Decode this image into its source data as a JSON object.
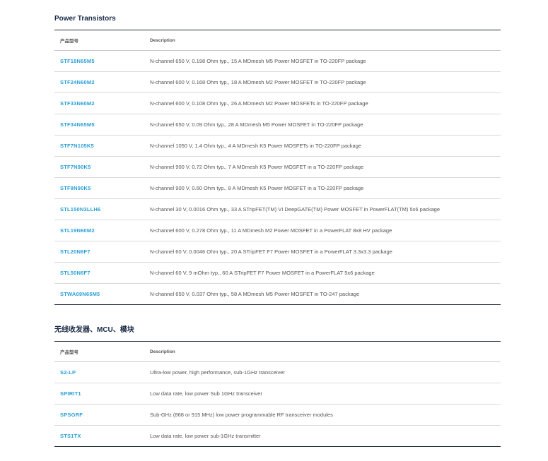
{
  "sections": [
    {
      "title": "Power Transistors",
      "header": {
        "part": "产品型号",
        "description": "Description"
      },
      "rows": [
        {
          "part": "STF18N65M5",
          "description": "N-channel 650 V, 0.198 Ohm typ., 15 A MDmesh M5 Power MOSFET in TO-220FP package"
        },
        {
          "part": "STF24N60M2",
          "description": "N-channel 600 V, 0.168 Ohm typ., 18 A MDmesh M2 Power MOSFET in TO-220FP package"
        },
        {
          "part": "STF33N60M2",
          "description": "N-channel 600 V, 0.108 Ohm typ., 26 A MDmesh M2 Power MOSFETs in TO-220FP package"
        },
        {
          "part": "STF34N65M5",
          "description": "N-channel 650 V, 0.09 Ohm typ., 28 A MDmesh M5 Power MOSFET in TO-220FP package"
        },
        {
          "part": "STF7N105K5",
          "description": "N-channel 1050 V, 1.4 Ohm typ., 4 A MDmesh K5 Power MOSFETs in TO-220FP package"
        },
        {
          "part": "STF7N90K5",
          "description": "N-channel 900 V, 0.72 Ohm typ., 7 A MDmesh K5 Power MOSFET in a TO-220FP package"
        },
        {
          "part": "STF8N90K5",
          "description": "N-channel 900 V, 0.60 Ohm typ., 8 A MDmesh K5 Power MOSFET in a TO-220FP package"
        },
        {
          "part": "STL150N3LLH6",
          "description": "N-channel 30 V, 0.0016 Ohm typ., 33 A STripFET(TM) VI DeepGATE(TM) Power MOSFET in PowerFLAT(TM) 5x6 package"
        },
        {
          "part": "STL19N60M2",
          "description": "N-channel 600 V, 0.278 Ohm typ., 11 A MDmesh M2 Power MOSFET in a PowerFLAT 8x8 HV package"
        },
        {
          "part": "STL20N6F7",
          "description": "N-channel 60 V, 0.0046 Ohm typ., 20 A STripFET F7 Power MOSFET in a PowerFLAT 3.3x3.3 package"
        },
        {
          "part": "STL50N6F7",
          "description": "N-channel 60 V, 9 mOhm typ., 60 A STripFET F7 Power MOSFET in a PowerFLAT 5x6 package"
        },
        {
          "part": "STWA69N65M5",
          "description": "N-channel 650 V, 0.037 Ohm typ., 58 A MDmesh M5 Power MOSFET in TO-247 package"
        }
      ]
    },
    {
      "title": "无线收发器、MCU、模块",
      "header": {
        "part": "产品型号",
        "description": "Description"
      },
      "rows": [
        {
          "part": "S2-LP",
          "description": "Ultra-low power, high performance, sub-1GHz transceiver"
        },
        {
          "part": "SPIRIT1",
          "description": "Low data rate, low power Sub 1GHz transceiver"
        },
        {
          "part": "SPSGRF",
          "description": "Sub-GHz (868 or 915 MHz) low power programmable RF transceiver modules"
        },
        {
          "part": "STS1TX",
          "description": "Low data rate, low power sub-1GHz transmitter"
        }
      ]
    }
  ],
  "colors": {
    "link": "#2a9fd6",
    "title": "#1a2a44",
    "rule_dark": "#1f2d3d"
  }
}
